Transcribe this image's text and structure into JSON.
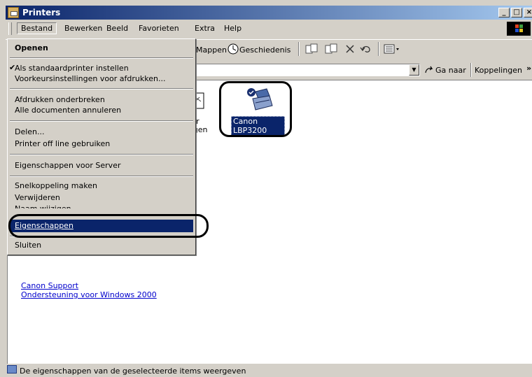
{
  "window": {
    "title": "Printers"
  },
  "menubar": {
    "items": [
      "Bestand",
      "Bewerken",
      "Beeld",
      "Favorieten",
      "Extra",
      "Help"
    ]
  },
  "toolbar": {
    "mappen_label": "Mappen",
    "history_label": "Geschiedenis"
  },
  "addressbar": {
    "goto_label": "Ga naar",
    "links_label": "Koppelingen",
    "more": "»"
  },
  "file_menu": {
    "open": "Openen",
    "set_default": "Als standaardprinter instellen",
    "preferences": "Voorkeursinstellingen voor afdrukken...",
    "pause": "Afdrukken onderbreken",
    "cancel_all": "Alle documenten annuleren",
    "sharing": "Delen...",
    "offline": "Printer off line gebruiken",
    "server_props": "Eigenschappen voor Server",
    "shortcut": "Snelkoppeling maken",
    "delete": "Verwijderen",
    "rename": "Naam wijzigen",
    "properties": "Eigenschappen",
    "close": "Sluiten",
    "default_checked": true
  },
  "printer": {
    "name": "Canon LBP3200",
    "partial_label_1": "ter",
    "partial_label_2": "egen"
  },
  "links": {
    "canon_support": "Canon Support",
    "windows_support": "Ondersteuning voor Windows 2000"
  },
  "statusbar": {
    "text": "De eigenschappen van de geselecteerde items weergeven"
  },
  "colors": {
    "titlebar": "#0a246a",
    "highlight": "#0a246a",
    "link": "#0000cc",
    "selection_text_bg": "#0a246a"
  }
}
